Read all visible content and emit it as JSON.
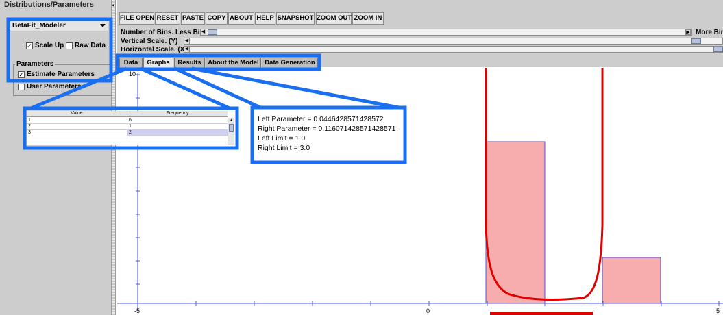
{
  "left_panel": {
    "title": "Distributions/Parameters",
    "distribution_select": "BetaFit_Modeler",
    "scale_up_label": "Scale Up",
    "scale_up_checked": true,
    "raw_data_label": "Raw Data",
    "raw_data_checked": false,
    "parameters_title": "Parameters",
    "estimate_label": "Estimate Parameters",
    "estimate_checked": true,
    "user_params_label": "User Parameters",
    "user_params_checked": false
  },
  "toolbar": {
    "buttons": [
      "FILE OPEN",
      "RESET",
      "PASTE",
      "COPY",
      "ABOUT",
      "HELP",
      "SNAPSHOT",
      "ZOOM OUT",
      "ZOOM IN"
    ],
    "bins_label": "Number of Bins.  Less Bins.",
    "more_bins_label": "More Bins",
    "vscale_label": "Vertical Scale. (Y)",
    "hscale_label": "Horizontal Scale. (X)"
  },
  "tabs": [
    "Data",
    "Graphs",
    "Results",
    "About the Model",
    "Data Generation"
  ],
  "active_tab": "Graphs",
  "table": {
    "headers": [
      "Value",
      "Frequency"
    ],
    "rows": [
      [
        "1",
        "6"
      ],
      [
        "2",
        "1"
      ],
      [
        "3",
        "2"
      ]
    ]
  },
  "params": {
    "left_parameter": "Left Parameter = 0.0446428571428572",
    "right_parameter": "Right Parameter = 0.116071428571428571",
    "left_limit": "Left Limit = 1.0",
    "right_limit": "Right Limit = 3.0"
  },
  "graph": {
    "y_top_label": "10",
    "x_labels": [
      "-5",
      "0",
      "5"
    ]
  },
  "colors": {
    "highlight": "#1a6ff0",
    "curve": "#e00000",
    "bar_fill": "#f7adad",
    "bar_stroke": "#5a50c8",
    "axis": "#4a5ad0"
  }
}
